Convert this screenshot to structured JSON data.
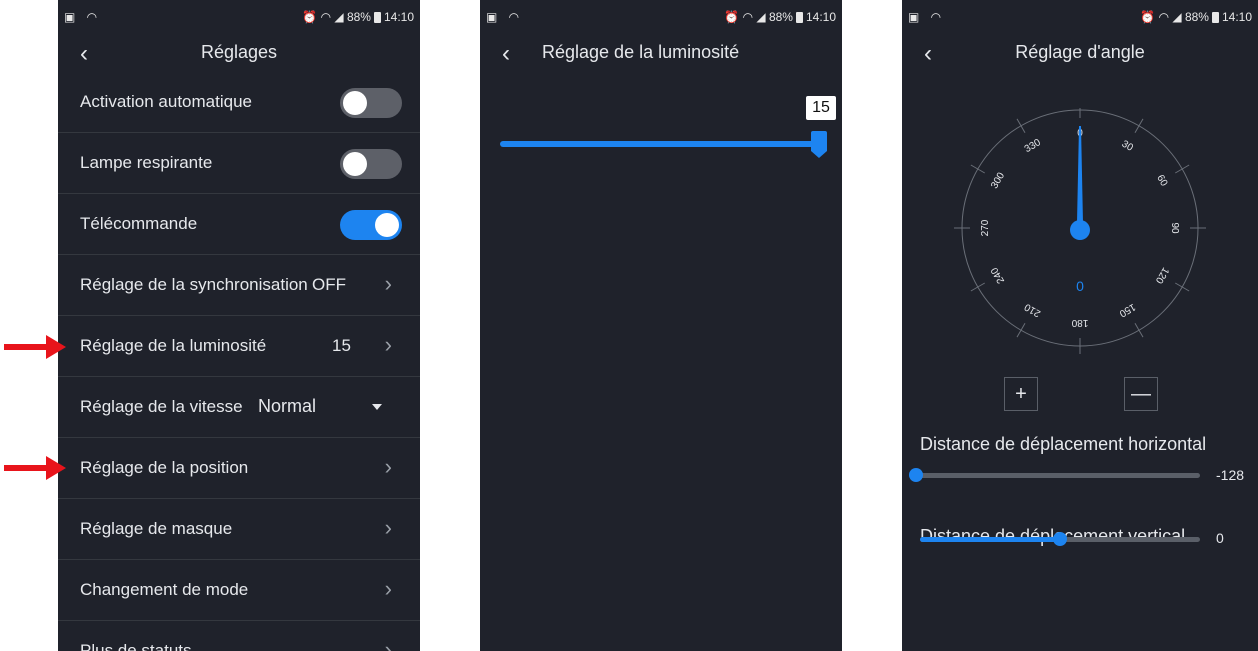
{
  "status_bar": {
    "left_icons": "▣ ◠",
    "right_text": "⏰ ◠ ◢ 88%",
    "time": "14:10"
  },
  "screen1": {
    "title": "Réglages",
    "back": "‹",
    "rows": [
      {
        "label": "Activation automatique",
        "toggle": "off"
      },
      {
        "label": "Lampe respirante",
        "toggle": "off"
      },
      {
        "label": "Télécommande",
        "toggle": "on"
      },
      {
        "label": "Réglage de la synchronisation",
        "value": "OFF",
        "chevron": "›"
      },
      {
        "label": "Réglage de la luminosité",
        "value": "15",
        "chevron": "›"
      },
      {
        "label": "Réglage de la vitesse",
        "value": "Normal",
        "dropdown": true
      },
      {
        "label": "Réglage de la position",
        "chevron": "›"
      },
      {
        "label": "Réglage de masque",
        "chevron": "›"
      },
      {
        "label": "Changement de mode",
        "chevron": "›"
      },
      {
        "label": "Plus de statuts",
        "chevron": "›"
      }
    ]
  },
  "screen2": {
    "title": "Réglage de la luminosité",
    "back": "‹",
    "brightness_value": "15",
    "brightness_fraction": 1.0
  },
  "screen3": {
    "title": "Réglage d'angle",
    "back": "‹",
    "dial_ticks": [
      "0",
      "30",
      "60",
      "90",
      "120",
      "150",
      "180",
      "210",
      "240",
      "270",
      "300",
      "330"
    ],
    "angle_value": "0",
    "plus_label": "+",
    "minus_label": "—",
    "horizontal_label": "Distance de déplacement horizontal",
    "horizontal_value": "-128",
    "horizontal_fraction": 0.0,
    "vertical_label": "Distance de déplacement vertical",
    "vertical_value": "0",
    "vertical_fraction": 0.5
  },
  "colors": {
    "accent": "#1d84f0",
    "background": "#1f222b",
    "annotation_arrow": "#e8141b"
  },
  "icons": {
    "back": "chevron-left-icon",
    "row_chevron": "chevron-right-icon",
    "dropdown": "caret-down-icon",
    "annotation": "red-arrow-icon"
  }
}
